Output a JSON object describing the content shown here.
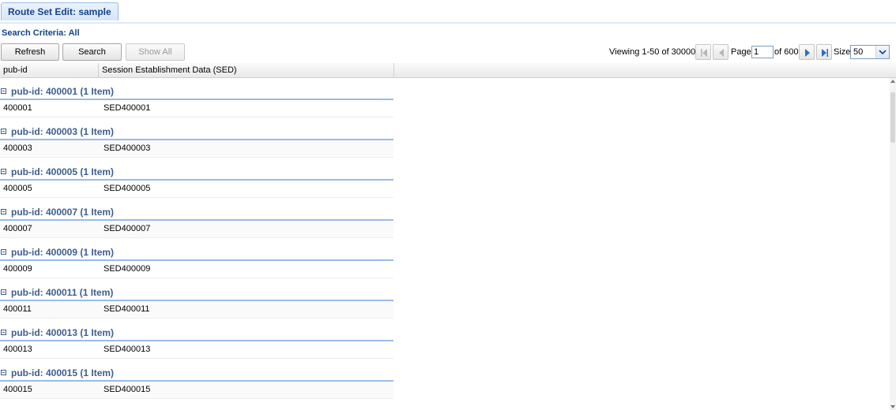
{
  "tab": {
    "title": "Route Set Edit: sample"
  },
  "criteria": {
    "text": "Search Criteria: All"
  },
  "toolbar": {
    "refresh": "Refresh",
    "search": "Search",
    "show_all": "Show All"
  },
  "pager": {
    "viewing": "Viewing 1-50 of 30000",
    "page_label": "Page",
    "page_value": "1",
    "of_label": "of 600",
    "size_label": "Size",
    "size_value": "50"
  },
  "columns": [
    "pub-id",
    "Session Establishment Data (SED)"
  ],
  "groups": [
    {
      "title": "pub-id: 400001 (1 Item)",
      "id": "400001",
      "sed": "SED400001"
    },
    {
      "title": "pub-id: 400003 (1 Item)",
      "id": "400003",
      "sed": "SED400003"
    },
    {
      "title": "pub-id: 400005 (1 Item)",
      "id": "400005",
      "sed": "SED400005"
    },
    {
      "title": "pub-id: 400007 (1 Item)",
      "id": "400007",
      "sed": "SED400007"
    },
    {
      "title": "pub-id: 400009 (1 Item)",
      "id": "400009",
      "sed": "SED400009"
    },
    {
      "title": "pub-id: 400011 (1 Item)",
      "id": "400011",
      "sed": "SED400011"
    },
    {
      "title": "pub-id: 400013 (1 Item)",
      "id": "400013",
      "sed": "SED400013"
    },
    {
      "title": "pub-id: 400015 (1 Item)",
      "id": "400015",
      "sed": "SED400015"
    }
  ],
  "icons": {
    "first": "first-page-icon",
    "prev": "prev-page-icon",
    "next": "next-page-icon",
    "last": "last-page-icon",
    "collapse": "collapse-icon",
    "dropdown": "chevron-down-icon"
  },
  "colors": {
    "accent": "#15428b",
    "group_text": "#3d5e8e",
    "border": "#99bbe8"
  }
}
